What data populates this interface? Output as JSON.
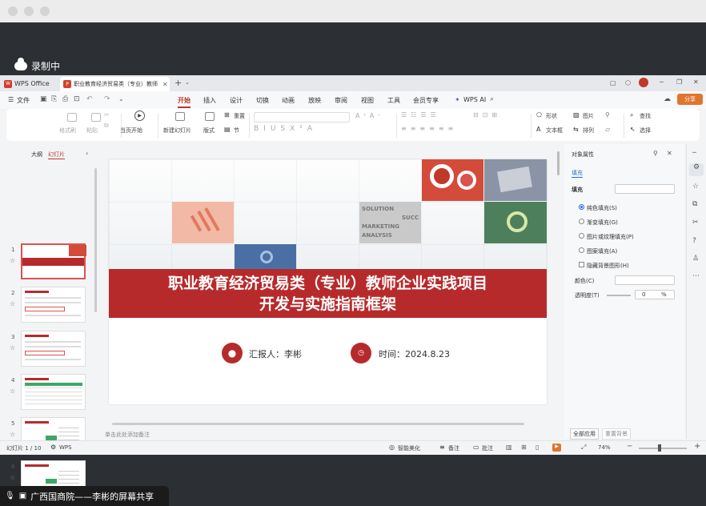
{
  "recording": {
    "label": "录制中"
  },
  "tabs": {
    "home_label": "WPS Office",
    "doc_title": "职业教育经济贸易类（专业）教师"
  },
  "ribbon": {
    "file": "文件",
    "tabs": [
      "开始",
      "插入",
      "设计",
      "切换",
      "动画",
      "放映",
      "审阅",
      "视图",
      "工具",
      "会员专享"
    ],
    "wps_ai": "WPS AI",
    "share": "分享",
    "tools": {
      "format_painter": "格式刷",
      "paste": "粘贴",
      "from_current": "当页开始",
      "new_slide": "新建幻灯片",
      "layout": "版式",
      "section": "节",
      "reset": "重置",
      "shape": "形状",
      "picture": "图片",
      "find": "查找",
      "textbox": "文本框",
      "arrange": "排列",
      "select": "选择"
    }
  },
  "left_panel": {
    "outline_tab": "大纲",
    "slides_tab": "幻灯片",
    "slide_numbers": [
      "1",
      "2",
      "3",
      "4",
      "5",
      "6"
    ],
    "add_icon": "+"
  },
  "slide": {
    "title_line1": "职业教育经济贸易类（专业）教师企业实践项目",
    "title_line2": "开发与实施指南框架",
    "reporter": "汇报人：李彬",
    "time": "时间：2024.8.23",
    "photo_words": [
      "SOLUTION",
      "SUCC",
      "MARKETING",
      "ANALYSIS"
    ]
  },
  "notes_placeholder": "单击此处添加备注",
  "object_panel": {
    "title": "对象属性",
    "fill_tab": "填充",
    "fill_section": "填充",
    "options": [
      "纯色填充(S)",
      "渐变填充(G)",
      "图片或纹理填充(P)",
      "图案填充(A)"
    ],
    "hide_bg": "隐藏背景图形(H)",
    "color_label": "颜色(C)",
    "transparency_label": "透明度(T)",
    "transparency_value": "0",
    "transparency_unit": "%",
    "apply_all": "全部应用",
    "reset_bg": "重置背景"
  },
  "status": {
    "slide_counter": "幻灯片 1 / 10",
    "theme": "WPS",
    "beautify": "智能美化",
    "notes": "备注",
    "comments": "批注",
    "zoom": "74%"
  },
  "screen_share": {
    "label": "广西国商院——李彬的屏幕共享"
  },
  "colors": {
    "accent": "#c0392b",
    "banner": "#b72a2c",
    "share": "#e0762b"
  }
}
